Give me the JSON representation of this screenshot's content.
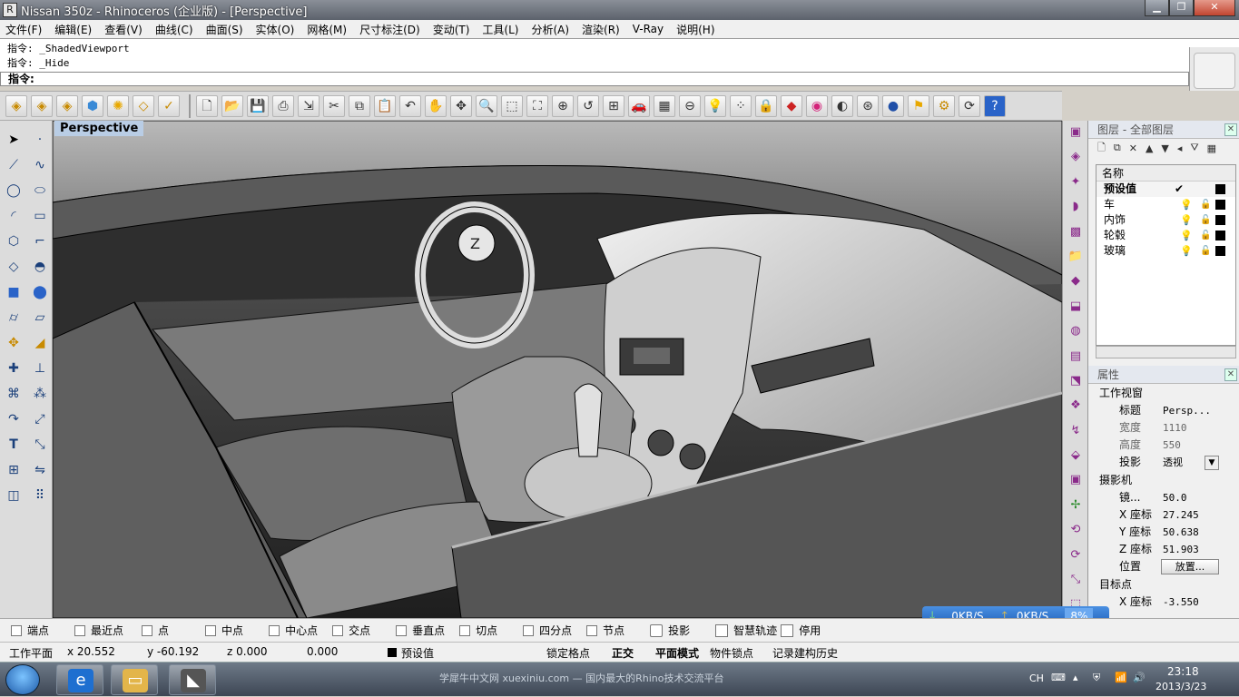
{
  "window": {
    "title": "Nissan 350z - Rhinoceros (企业版) - [Perspective]",
    "min_icon": "minimize-icon",
    "max_icon": "maximize-icon",
    "close_icon": "close-icon"
  },
  "menu": [
    "文件(F)",
    "编辑(E)",
    "查看(V)",
    "曲线(C)",
    "曲面(S)",
    "实体(O)",
    "网格(M)",
    "尺寸标注(D)",
    "变动(T)",
    "工具(L)",
    "分析(A)",
    "渲染(R)",
    "V-Ray",
    "说明(H)"
  ],
  "command": {
    "history": [
      "指令: _ShadedViewport",
      "指令: _Hide"
    ],
    "prompt": "指令:"
  },
  "viewport": {
    "label": "Perspective"
  },
  "layers": {
    "title": "图层 - 全部图层",
    "column": "名称",
    "rows": [
      {
        "name": "预设值"
      },
      {
        "name": "车"
      },
      {
        "name": "内饰"
      },
      {
        "name": "轮毂"
      },
      {
        "name": "玻璃"
      }
    ]
  },
  "properties": {
    "title": "属性",
    "section": "工作视窗",
    "rows": [
      {
        "k": "标题",
        "v": "Persp..."
      },
      {
        "k": "宽度",
        "v": "1110"
      },
      {
        "k": "高度",
        "v": "550"
      },
      {
        "k": "投影",
        "v": "透视"
      }
    ],
    "camera_title": "摄影机",
    "camera": [
      {
        "k": "镜...",
        "v": "50.0"
      },
      {
        "k": "X 座标",
        "v": "27.245"
      },
      {
        "k": "Y 座标",
        "v": "50.638"
      },
      {
        "k": "Z 座标",
        "v": "51.903"
      }
    ],
    "position_label": "位置",
    "position_button": "放置...",
    "target_title": "目标点",
    "target_x": {
      "k": "X 座标",
      "v": "-3.550"
    }
  },
  "netmeter": {
    "down": "0KB/S",
    "up": "0KB/S",
    "pct": "8%"
  },
  "osnap": [
    "端点",
    "最近点",
    "点",
    "中点",
    "中心点",
    "交点",
    "垂直点",
    "切点",
    "四分点",
    "节点",
    "投影",
    "智慧轨迹",
    "停用"
  ],
  "status": {
    "cplane": "工作平面",
    "x": "x 20.552",
    "y": "y -60.192",
    "z": "z 0.000",
    "d": "0.000",
    "layer": "预设值",
    "grid": "锁定格点",
    "ortho": "正交",
    "planar": "平面模式",
    "osnap": "物件锁点",
    "history": "记录建构历史"
  },
  "taskbar": {
    "watermark": "学犀牛中文网 xuexiniu.com — 国内最大的Rhino技术交流平台",
    "lang": "CH",
    "time": "23:18",
    "date": "2013/3/23"
  }
}
